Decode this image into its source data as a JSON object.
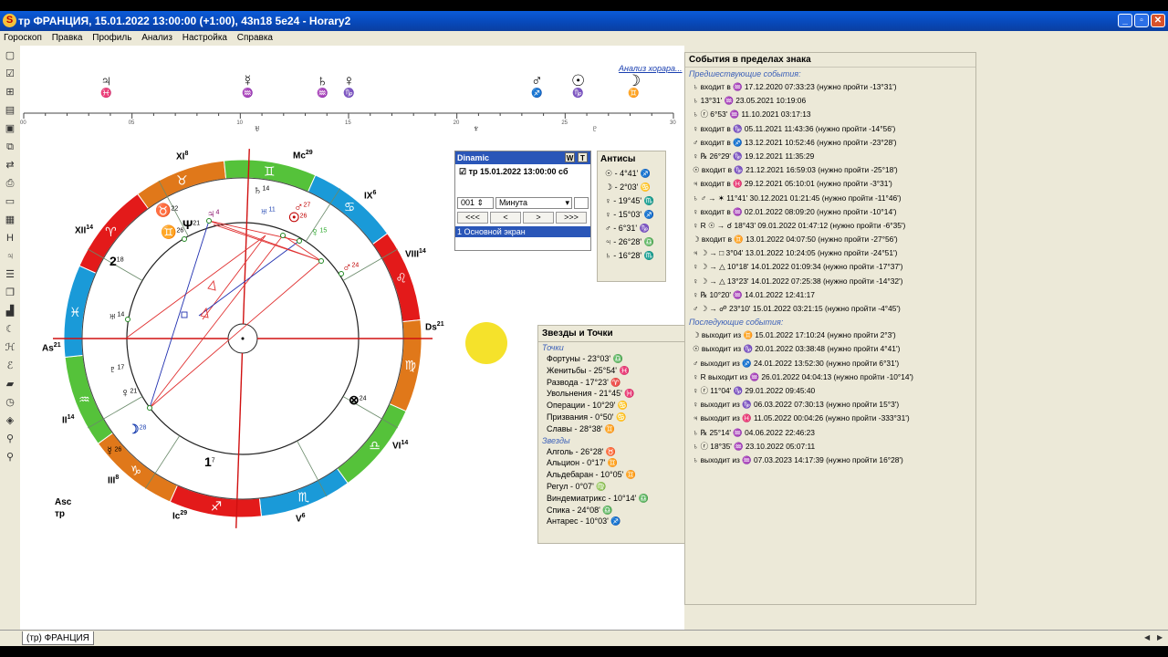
{
  "window": {
    "title": "тр ФРАНЦИЯ, 15.01.2022 13:00:00 (+1:00), 43n18 5e24 - Horary2",
    "app_icon": "S"
  },
  "menu": [
    "Гороскоп",
    "Правка",
    "Профиль",
    "Анализ",
    "Настройка",
    "Справка"
  ],
  "link_analysis": "Анализ хорара...",
  "ruler": {
    "ticks": [
      "00",
      "05",
      "10",
      "15",
      "20",
      "25",
      "30"
    ]
  },
  "ruler_planets": [
    {
      "sym": "♃",
      "sign": "♓",
      "color": "#800060",
      "r": ""
    },
    {
      "sym": "☿",
      "sign": "♒",
      "color": "#1a3fb0",
      "r": "R"
    },
    {
      "sym": "♄",
      "sign": "♒",
      "color": "#1a3fb0",
      "r": ""
    },
    {
      "sym": "♀",
      "sign": "♑",
      "color": "#1a8a1a",
      "r": "R"
    },
    {
      "sym": "♂",
      "sign": "♐",
      "color": "#c00000",
      "r": ""
    },
    {
      "sym": "☉",
      "sign": "♑",
      "color": "#1a8a1a",
      "r": ""
    },
    {
      "sym": "☽",
      "sign": "♊",
      "color": "#1a3fb0",
      "r": ""
    }
  ],
  "ruler_small": [
    "♅",
    "♆",
    "♇"
  ],
  "houses": {
    "I": "As",
    "I_deg": "21",
    "VII": "Ds",
    "VII_deg": "21",
    "X": "Mc",
    "X_deg": "29",
    "IV": "Ic",
    "IV_deg": "29",
    "XI": "XI",
    "XI_deg": "8",
    "XII": "XII",
    "XII_deg": "14",
    "II": "II",
    "II_deg": "14",
    "III": "III",
    "III_deg": "8",
    "V": "V",
    "V_deg": "6",
    "VI": "VI",
    "VI_deg": "14",
    "VIII": "VIII",
    "VIII_deg": "14",
    "IX": "IX",
    "IX_deg": "6"
  },
  "zodiac_signs": [
    "♈",
    "♉",
    "♊",
    "♋",
    "♌",
    "♍",
    "♎",
    "♏",
    "♐",
    "♑",
    "♒",
    "♓"
  ],
  "chart_planets": [
    {
      "label": "♄",
      "deg": "14"
    },
    {
      "label": "♅",
      "deg": "11"
    },
    {
      "label": "♂",
      "deg": "27"
    },
    {
      "label": "♀",
      "deg": "15"
    },
    {
      "label": "☉",
      "deg": "26"
    },
    {
      "label": "♂",
      "deg": "24"
    },
    {
      "label": "♃",
      "deg": "4"
    },
    {
      "label": "Ψ",
      "deg": "21"
    },
    {
      "label": "♅",
      "deg": "14"
    },
    {
      "label": "♇",
      "deg": "17"
    },
    {
      "label": "☽",
      "deg": "28"
    },
    {
      "label": "☿",
      "deg": "26"
    },
    {
      "label": "2",
      "deg": "18"
    },
    {
      "label": "♀",
      "deg": "21"
    },
    {
      "label": "♉",
      "deg": "22"
    },
    {
      "label": "♊",
      "deg": "26"
    },
    {
      "label": "1",
      "deg": "7"
    },
    {
      "label": "⊗",
      "deg": "24"
    }
  ],
  "asc_label": [
    "Asc",
    "тр"
  ],
  "dinamic": {
    "title": "Dinamic",
    "btn_w": "W",
    "btn_t": "T",
    "entry": "тр 15.01.2022 13:00:00 сб",
    "step": "001",
    "unit": "Минута",
    "nav": [
      "<<<",
      "<",
      ">",
      ">>>"
    ],
    "screen": "1 Основной экран"
  },
  "antisy": {
    "title": "Антисы",
    "rows": [
      "☉ - 4°41' ♐",
      "☽ - 2°03' ♋",
      "♀ - 19°45' ♏",
      "♀ - 15°03' ♐",
      "♂ - 6°31' ♑",
      "♃ - 26°28' ♎",
      "♄ - 16°28' ♏"
    ]
  },
  "stars": {
    "title": "Звезды и Точки",
    "points_label": "Точки",
    "points": [
      "Фортуны - 23°03' ♎",
      "Женитьбы - 25°54' ♓",
      "Развода - 17°23' ♈",
      "Увольнения - 21°45' ♓",
      "Операции - 10°29' ♋",
      "Призвания - 0°50' ♋",
      "Славы - 28°38' ♊"
    ],
    "stars_label": "Звезды",
    "stars": [
      "Алголь - 26°28' ♉",
      "Альцион - 0°17' ♊",
      "Альдебаран - 10°05' ♊",
      "Регул - 0°07' ♍",
      "Виндемиатрикс - 10°14' ♎",
      "Спика - 24°08' ♎",
      "Антарес - 10°03' ♐"
    ]
  },
  "events": {
    "title": "События в пределах знака",
    "prev_label": "Предшествующие события:",
    "prev": [
      "♄ входит в ♒ 17.12.2020 07:33:23 (нужно пройти -13°31')",
      "♄ 13°31' ♒ 23.05.2021 10:19:06",
      "♄ ⓡ 6°53' ♒ 11.10.2021 03:17:13",
      "♀ входит в ♑ 05.11.2021 11:43:36 (нужно пройти -14°56')",
      "♂ входит в ♐ 13.12.2021 10:52:46 (нужно пройти -23°28')",
      "♀ ℞ 26°29' ♑ 19.12.2021 11:35:29",
      "☉ входит в ♑ 21.12.2021 16:59:03 (нужно пройти -25°18')",
      "♃ входит в ♓ 29.12.2021 05:10:01 (нужно пройти -3°31')",
      "♄ ♂ → ✶ 11°41' 30.12.2021 01:21:45 (нужно пройти -11°46')",
      "♀ входит в ♒ 02.01.2022 08:09:20 (нужно пройти -10°14')",
      "♀ R ☉ → ☌ 18°43' 09.01.2022 01:47:12 (нужно пройти -6°35')",
      "☽ входит в ♊ 13.01.2022 04:07:50 (нужно пройти -27°56')",
      "♃ ☽ → □ 3°04' 13.01.2022 10:24:05 (нужно пройти -24°51')",
      "♀ ☽ → △ 10°18' 14.01.2022 01:09:34 (нужно пройти -17°37')",
      "♀ ☽ → △ 13°23' 14.01.2022 07:25:38 (нужно пройти -14°32')",
      "♀ ℞ 10°20' ♒ 14.01.2022 12:41:17",
      "♂ ☽ → ☍ 23°10' 15.01.2022 03:21:15 (нужно пройти -4°45')"
    ],
    "next_label": "Последующие события:",
    "next": [
      "☽ выходит из ♊ 15.01.2022 17:10:24 (нужно пройти 2°3')",
      "☉ выходит из ♑ 20.01.2022 03:38:48 (нужно пройти 4°41')",
      "♂ выходит из ♐ 24.01.2022 13:52:30 (нужно пройти 6°31')",
      "♀ R выходит из ♒ 26.01.2022 04:04:13 (нужно пройти -10°14')",
      "♀ ⓡ 11°04' ♑ 29.01.2022 09:45:40",
      "♀ выходит из ♑ 06.03.2022 07:30:13 (нужно пройти 15°3')",
      "♃ выходит из ♓ 11.05.2022 00:04:26 (нужно пройти -333°31')",
      "♄ ℞ 25°14' ♒ 04.06.2022 22:46:23",
      "♄ ⓡ 18°35' ♒ 23.10.2022 05:07:11",
      "♄ выходит из ♒ 07.03.2023 14:17:39 (нужно пройти 16°28')"
    ]
  },
  "tab": "(тр) ФРАНЦИЯ",
  "colors": {
    "fire": "#e31a1a",
    "earth": "#e0781a",
    "air": "#55c23a",
    "water": "#1a9ad8",
    "aspect_red": "#e03030",
    "aspect_blue": "#2030b0"
  }
}
